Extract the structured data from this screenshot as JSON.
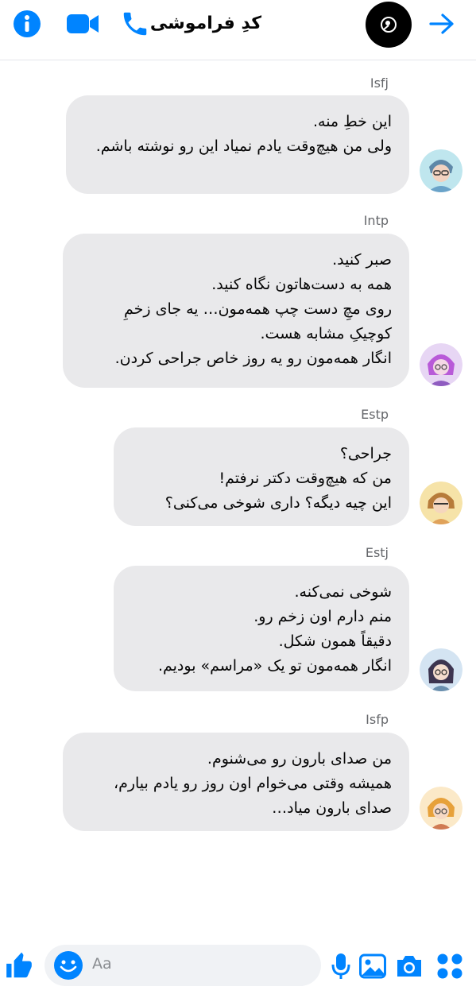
{
  "header": {
    "title": "کدِ فراموشی",
    "icons": [
      "info-icon",
      "video-call-icon",
      "phone-icon",
      "back-arrow-icon"
    ],
    "accent_color": "#0084ff"
  },
  "messages": [
    {
      "sender": "Isfj",
      "text": "این خطِ منه.\nولی من هیچ‌وقت یادم نمیاد این رو نوشته باشم."
    },
    {
      "sender": "Intp",
      "text": "صبر کنید.\nهمه به دست‌هاتون نگاه کنید.\nروی مچِ دست چپ همه‌مون… یه جای زخمِ کوچیکِ مشابه هست.\nانگار همه‌مون رو یه روز خاص جراحی کردن."
    },
    {
      "sender": "Estp",
      "text": "جراحی؟\nمن که هیچ‌وقت دکتر نرفتم!\nاین چیه دیگه؟ داری شوخی می‌کنی؟"
    },
    {
      "sender": "Estj",
      "text": "شوخی نمی‌کنه.\nمنم دارم اون زخم رو.\nدقیقاً همون شکل.\nانگار همه‌مون تو یک «مراسم» بودیم."
    },
    {
      "sender": "Isfp",
      "text": "من صدای بارون رو می‌شنوم.\nهمیشه وقتی می‌خوام اون روز رو یادم بیارم، صدای بارون میاد…"
    }
  ],
  "composer": {
    "placeholder": "Aa",
    "icons": [
      "like-icon",
      "emoji-icon",
      "microphone-icon",
      "gallery-icon",
      "camera-icon",
      "apps-icon"
    ]
  }
}
